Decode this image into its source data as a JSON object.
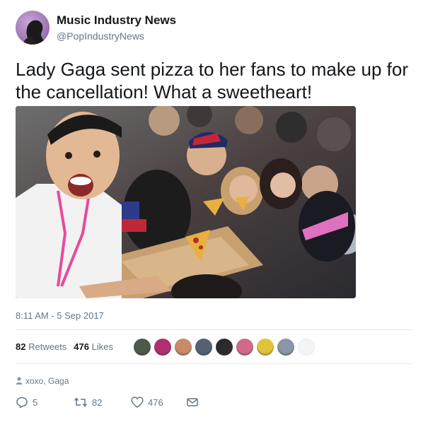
{
  "account": {
    "display_name": "Music Industry News",
    "handle": "@PopIndustryNews",
    "avatar_icon": "profile-avatar"
  },
  "tweet": {
    "text": "Lady Gaga sent pizza to her fans to make up for the cancellation! What a sweetheart!",
    "photo": "crowd-selfie-with-pizza",
    "timestamp": "8:11 AM - 5 Sep 2017"
  },
  "stats": {
    "retweets_count": "82",
    "retweets_label": "Retweets",
    "likes_count": "476",
    "likes_label": "Likes"
  },
  "likers_colors": [
    "#4d5a4a",
    "#b0306e",
    "#c98a6a",
    "#556070",
    "#2b2b2b",
    "#d46a8a",
    "#e2c23a",
    "#8a96a8",
    "#f2f2f2"
  ],
  "location": {
    "icon": "person-pin-icon",
    "text": "xoxo, Gaga"
  },
  "actions": {
    "reply_count": "5",
    "retweet_count": "82",
    "like_count": "476"
  },
  "colors": {
    "text": "#14171a",
    "secondary": "#657786",
    "divider": "#e6ecf0"
  }
}
